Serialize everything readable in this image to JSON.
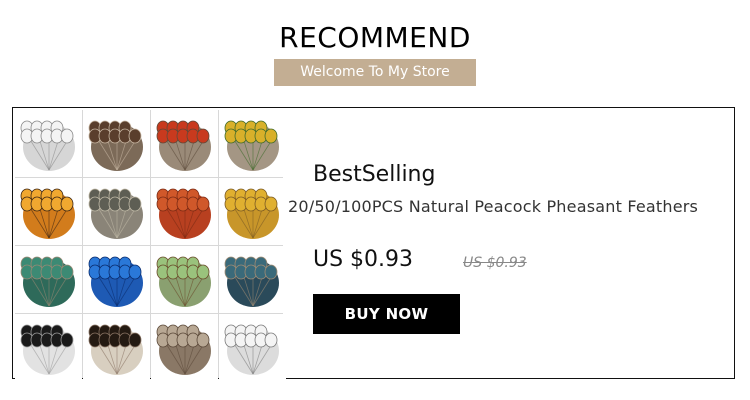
{
  "header": {
    "title": "RECOMMEND",
    "banner": "Welcome To My Store"
  },
  "product": {
    "section_label": "BestSelling",
    "name": "20/50/100PCS Natural Peacock Pheasant Feathers",
    "price": "US $0.93",
    "original_price": "US $0.93",
    "buy_label": "BUY NOW",
    "image_tiles": [
      {
        "icon": "white-grey-feather-icon",
        "fill": "#d6d6d6",
        "tip": "#f4f4f4",
        "accent": "#888888"
      },
      {
        "icon": "brown-spotted-feather-icon",
        "fill": "#7c6a58",
        "tip": "#5a3e2c",
        "accent": "#c9b8a4"
      },
      {
        "icon": "red-tipped-feather-icon",
        "fill": "#9a8a78",
        "tip": "#c83a1e",
        "accent": "#5c4a3a"
      },
      {
        "icon": "yellow-green-feather-icon",
        "fill": "#a49684",
        "tip": "#d8b02a",
        "accent": "#3e6a2a"
      },
      {
        "icon": "orange-barred-feather-icon",
        "fill": "#d27c1c",
        "tip": "#f0a830",
        "accent": "#3a2414"
      },
      {
        "icon": "grey-speckled-feather-icon",
        "fill": "#8a8478",
        "tip": "#5e5e54",
        "accent": "#c2bba8"
      },
      {
        "icon": "red-orange-feather-icon",
        "fill": "#b84020",
        "tip": "#d0582a",
        "accent": "#7a2a14"
      },
      {
        "icon": "golden-feather-icon",
        "fill": "#c8962a",
        "tip": "#e0b030",
        "accent": "#7a5a24"
      },
      {
        "icon": "teal-green-feather-icon",
        "fill": "#2e6a5a",
        "tip": "#3c8a74",
        "accent": "#9a8874"
      },
      {
        "icon": "blue-peacock-feather-icon",
        "fill": "#1e5ab4",
        "tip": "#2a78d8",
        "accent": "#0a2a6a"
      },
      {
        "icon": "green-scaled-feather-icon",
        "fill": "#8aa070",
        "tip": "#9ac27c",
        "accent": "#6a4a2a"
      },
      {
        "icon": "dark-teal-feather-icon",
        "fill": "#2a4a5a",
        "tip": "#3a6a7a",
        "accent": "#a08c74"
      },
      {
        "icon": "black-white-feather-icon",
        "fill": "#e2e2e2",
        "tip": "#1a1a1a",
        "accent": "#9a9a9a"
      },
      {
        "icon": "black-brown-scaled-feather-icon",
        "fill": "#d8cfc0",
        "tip": "#241a12",
        "accent": "#8a7464"
      },
      {
        "icon": "brown-pointed-feather-icon",
        "fill": "#8a7866",
        "tip": "#b8a894",
        "accent": "#5a4838"
      },
      {
        "icon": "white-pointed-feather-icon",
        "fill": "#dcdcdc",
        "tip": "#f4f4f4",
        "accent": "#7a7a7a"
      }
    ]
  },
  "colors": {
    "banner": "#c3ae93",
    "buy_button": "#000000",
    "old_price": "#888888"
  }
}
